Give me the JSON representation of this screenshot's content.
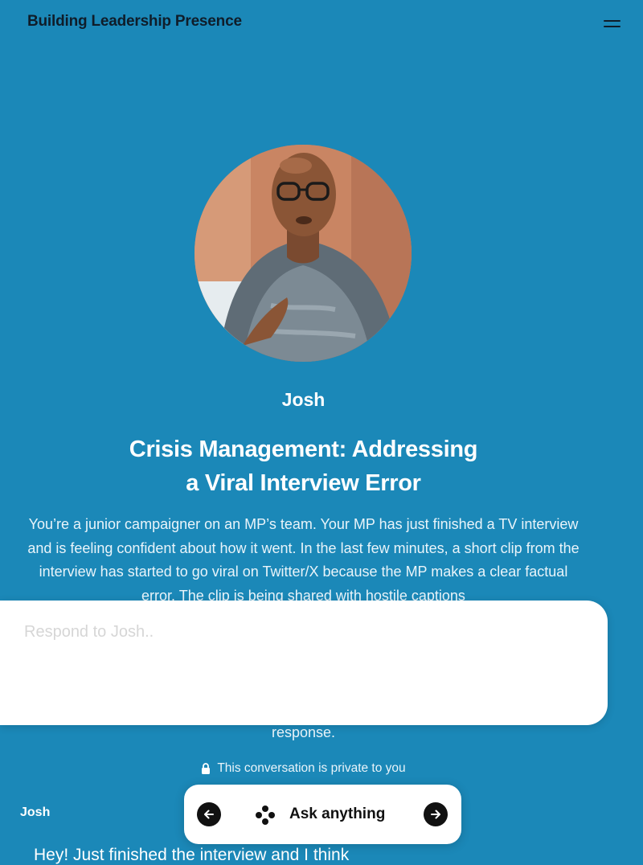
{
  "header": {
    "title": "Building Leadership Presence",
    "menu_icon": "hamburger-menu-icon"
  },
  "persona": {
    "name": "Josh",
    "avatar_description_icon": "avatar-photo"
  },
  "scenario": {
    "title_line1": "Crisis Management: Addressing",
    "title_line2": "a Viral Interview Error",
    "description": "You’re a junior campaigner on an MP’s team. Your MP has just finished a TV interview and is feeling confident about how it went. In the last few minutes, a short clip from the interview has started to go viral on Twitter/X because the MP makes a clear factual error. The clip is being shared with hostile captions",
    "description_tail": "response."
  },
  "input": {
    "placeholder": "Respond to Josh.."
  },
  "privacy": {
    "text": "This conversation is private to you",
    "icon": "lock-icon"
  },
  "conversation": {
    "speaker": "Josh",
    "first_message": "Hey! Just finished the interview and I think"
  },
  "action_bar": {
    "ask_label": "Ask anything",
    "back_icon": "arrow-left-icon",
    "forward_icon": "arrow-right-icon",
    "ask_icon": "sparkle-dots-icon"
  }
}
